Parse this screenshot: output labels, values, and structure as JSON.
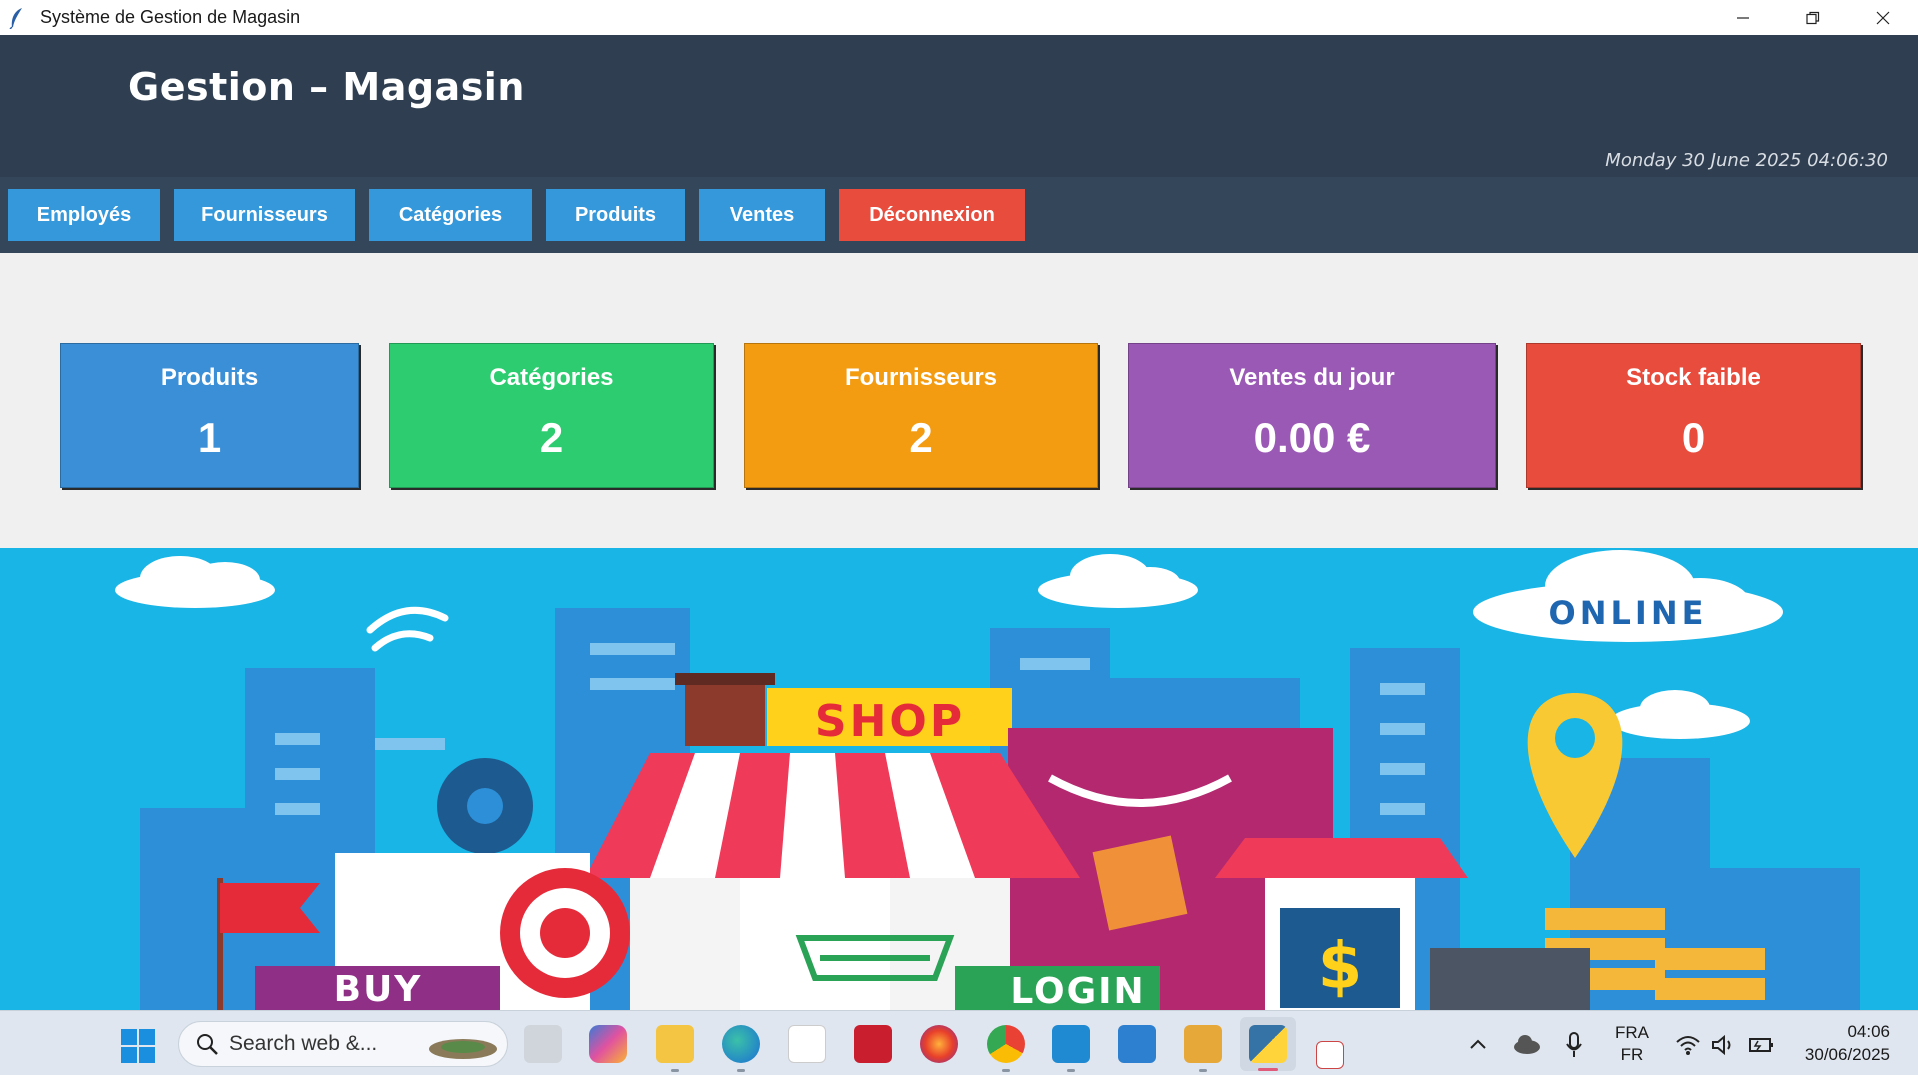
{
  "window": {
    "title": "Système de Gestion de Magasin",
    "icon": "feather-icon"
  },
  "header": {
    "title": "Gestion – Magasin",
    "datetime": "Monday 30 June 2025  04:06:30"
  },
  "nav": {
    "items": [
      {
        "label": "Employés"
      },
      {
        "label": "Fournisseurs"
      },
      {
        "label": "Catégories"
      },
      {
        "label": "Produits"
      },
      {
        "label": "Ventes"
      },
      {
        "label": "Déconnexion"
      }
    ]
  },
  "stats": {
    "cards": [
      {
        "label": "Produits",
        "value": "1",
        "color": "#3b8fd6"
      },
      {
        "label": "Catégories",
        "value": "2",
        "color": "#2ecc71"
      },
      {
        "label": "Fournisseurs",
        "value": "2",
        "color": "#f39c12"
      },
      {
        "label": "Ventes du jour",
        "value": "0.00 €",
        "color": "#9b59b6"
      },
      {
        "label": "Stock faible",
        "value": "0",
        "color": "#e74c3c"
      }
    ]
  },
  "banner": {
    "shop_sign": "SHOP",
    "cloud_sign": "ONLINE",
    "buy_sign": "BUY",
    "login_sign": "LOGIN",
    "dollar": "$"
  },
  "taskbar": {
    "search_placeholder": "Search web &...",
    "language": "FRA",
    "keyboard": "FR",
    "time": "04:06",
    "date": "30/06/2025"
  },
  "colors": {
    "header_bg": "#2f3e50",
    "nav_bg": "#344659",
    "nav_button": "#3498db",
    "logout_button": "#e74c3c",
    "banner_bg": "#18b5e6"
  }
}
